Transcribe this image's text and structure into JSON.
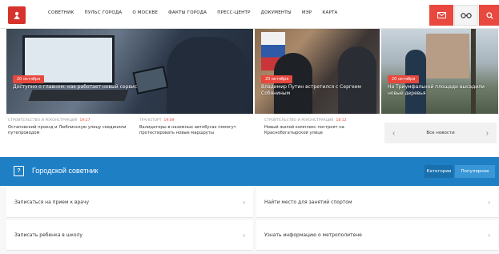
{
  "header": {
    "nav": [
      "СОВЕТНИК",
      "ПУЛЬС ГОРОДА",
      "О МОСКВЕ",
      "ФАКТЫ ГОРОДА",
      "ПРЕСС-ЦЕНТР",
      "ДОКУМЕНТЫ",
      "МЭР",
      "КАРТА"
    ]
  },
  "hero": {
    "tiles": [
      {
        "date": "20 октября",
        "caption": "Доступно о главном: как работает новый сервис"
      },
      {
        "date": "20 октября",
        "caption": "Владимир Путин встретился с Сергеем Собяниным"
      },
      {
        "date": "20 октября",
        "caption": "На Триумфальной площади высадили новые деревья"
      }
    ]
  },
  "news": {
    "items": [
      {
        "category": "СТРОИТЕЛЬСТВО И РЕКОНСТРУКЦИЯ",
        "time": "19:27",
        "text": "Остаповский проезд и Люблинскую улицу соединили путепроводом"
      },
      {
        "category": "ТРАНСПОРТ",
        "time": "19:09",
        "text": "Валидаторы в наземных автобусах помогут протестировать новые маршруты"
      },
      {
        "category": "СТРОИТЕЛЬСТВО И РЕКОНСТРУКЦИЯ",
        "time": "18:12",
        "text": "Новый жилой комплекс построят на Краснобогатырской улице"
      }
    ],
    "all_label": "Все новости",
    "prev_arrow": "‹",
    "next_arrow": "›"
  },
  "advisor": {
    "icon_glyph": "?",
    "title": "Городской советник",
    "tab_categories": "Категории",
    "tab_popular": "Популярное"
  },
  "links": [
    "Записаться на прием к врачу",
    "Найти место для занятий спортом",
    "Записать ребенка в школу",
    "Узнать информацию о метрополитене"
  ],
  "chevron": "›",
  "colors": {
    "accent_red": "#e8483e",
    "advisor_blue": "#1e7fc5"
  }
}
